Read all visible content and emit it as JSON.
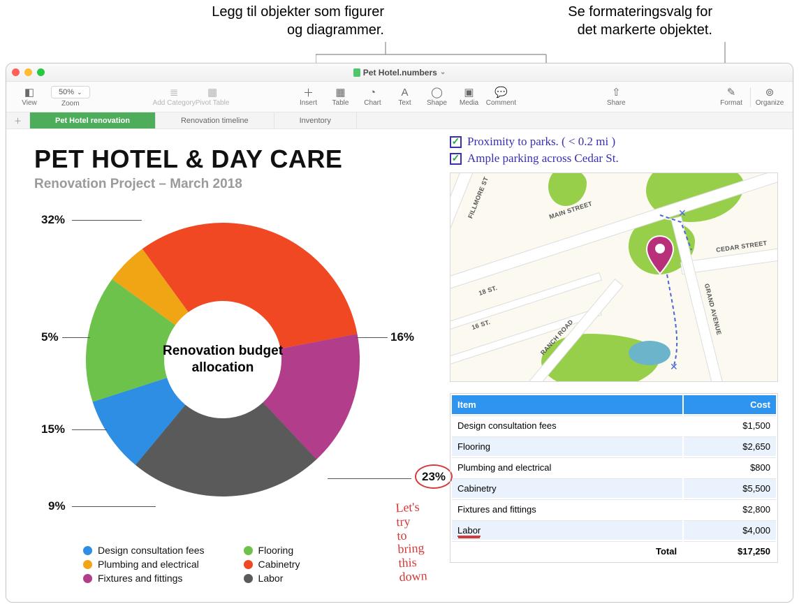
{
  "callouts": {
    "left": "Legg til objekter som figurer\nog diagrammer.",
    "right": "Se formateringsvalg for\ndet markerte objektet."
  },
  "window": {
    "title": "Pet Hotel.numbers"
  },
  "toolbar": {
    "view": "View",
    "zoom_value": "50%",
    "zoom_label": "Zoom",
    "add_category": "Add Category",
    "pivot_table": "Pivot Table",
    "insert": "Insert",
    "table": "Table",
    "chart": "Chart",
    "text": "Text",
    "shape": "Shape",
    "media": "Media",
    "comment": "Comment",
    "share": "Share",
    "format": "Format",
    "organize": "Organize"
  },
  "tabs": {
    "t0": "Pet Hotel renovation",
    "t1": "Renovation timeline",
    "t2": "Inventory"
  },
  "doc": {
    "title": "PET HOTEL & DAY CARE",
    "subtitle": "Renovation Project – March 2018"
  },
  "chart_data": {
    "type": "pie",
    "title": "Renovation budget allocation",
    "series": [
      {
        "name": "Design consultation fees",
        "value": 9,
        "color": "#2e8ee4"
      },
      {
        "name": "Flooring",
        "value": 15,
        "color": "#6dc24b"
      },
      {
        "name": "Plumbing and electrical",
        "value": 5,
        "color": "#f0a514"
      },
      {
        "name": "Cabinetry",
        "value": 32,
        "color": "#ef4823"
      },
      {
        "name": "Fixtures and fittings",
        "value": 16,
        "color": "#b23d8a"
      },
      {
        "name": "Labor",
        "value": 23,
        "color": "#5a5a5a"
      }
    ],
    "labels": {
      "p32": "32%",
      "p16": "16%",
      "p23": "23%",
      "p9": "9%",
      "p15": "15%",
      "p5": "5%"
    },
    "annotation": "Let's try\nto bring\nthis down"
  },
  "legend": {
    "l0": "Design consultation fees",
    "l1": "Flooring",
    "l2": "Plumbing and electrical",
    "l3": "Cabinetry",
    "l4": "Fixtures and fittings",
    "l5": "Labor"
  },
  "checklist": {
    "c0": "Proximity to parks. ( < 0.2 mi )",
    "c1": "Ample parking across Cedar St."
  },
  "map_labels": {
    "fillmore": "FILLMORE ST",
    "main": "MAIN STREET",
    "cedar": "CEDAR STREET",
    "ranch": "RANCH ROAD",
    "grand": "GRAND AVENUE",
    "n18": "18 ST.",
    "n16": "16 ST."
  },
  "table": {
    "h_item": "Item",
    "h_cost": "Cost",
    "rows": [
      {
        "item": "Design consultation fees",
        "cost": "$1,500"
      },
      {
        "item": "Flooring",
        "cost": "$2,650"
      },
      {
        "item": "Plumbing and electrical",
        "cost": "$800"
      },
      {
        "item": "Cabinetry",
        "cost": "$5,500"
      },
      {
        "item": "Fixtures and fittings",
        "cost": "$2,800"
      },
      {
        "item": "Labor",
        "cost": "$4,000"
      }
    ],
    "total_label": "Total",
    "total_value": "$17,250"
  }
}
